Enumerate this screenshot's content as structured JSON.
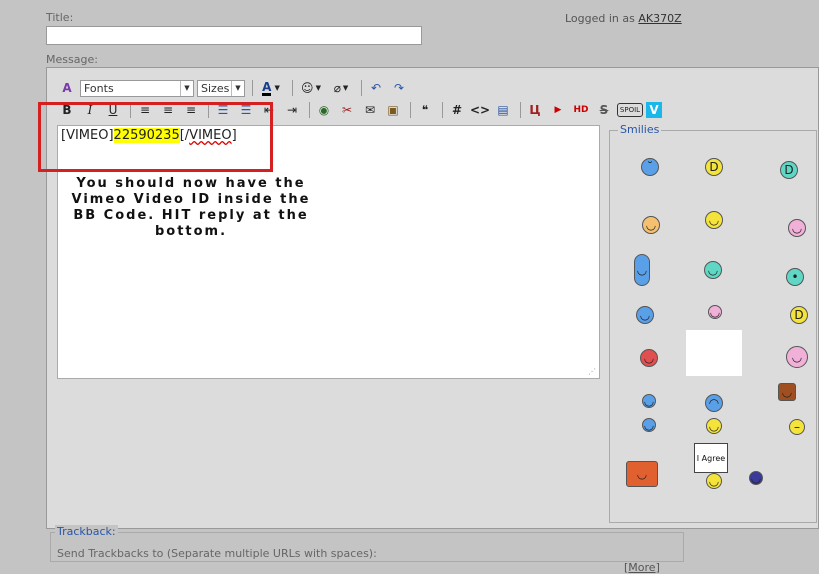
{
  "title_label": "Title:",
  "logged_in": {
    "prefix": "Logged in as",
    "user": "AK370Z"
  },
  "message_label": "Message:",
  "toolbar": {
    "fonts": "Fonts",
    "sizes": "Sizes",
    "row1_icons": [
      "remove-format-icon",
      "font-color-icon",
      "smiley-menu-icon",
      "attach-icon",
      "undo-icon",
      "redo-icon"
    ],
    "row2_icons": [
      "bold-icon",
      "italic-icon",
      "underline-icon",
      "align-left-icon",
      "align-center-icon",
      "align-right-icon",
      "ordered-list-icon",
      "unordered-list-icon",
      "outdent-icon",
      "indent-icon",
      "insert-link-icon",
      "unlink-icon",
      "insert-email-icon",
      "insert-image-icon",
      "quote-icon",
      "code-hash-icon",
      "code-html-icon",
      "php-icon",
      "youtube-alt-icon",
      "youtube-icon",
      "youtube-hd-icon",
      "strike-icon",
      "spoiler-icon",
      "vimeo-icon"
    ],
    "bold": "B",
    "italic": "I",
    "underline": "U",
    "hash": "#",
    "html": "<>",
    "strike": "S",
    "spoil": "SPOIL",
    "vimeo": "V"
  },
  "editor": {
    "tag_open": "[VIMEO]",
    "video_id": "22590235",
    "tag_close_slash": "[/",
    "tag_close_name": "VIMEO",
    "tag_close_end": "]"
  },
  "instruction_text": "You should now have the Vimeo Video ID inside the BB Code. HIT reply at the bottom.",
  "smilies": {
    "legend": "Smilies",
    "more": "More",
    "sign_text": "I Agree",
    "icons": [
      "blue-sad-smiley",
      "laughing-smiley",
      "thumbs-up-smiley",
      "hat-smiley",
      "cheer-smiley",
      "pink-smiley",
      "blue-figure-smiley",
      "teal-figure-smiley",
      "slug-smiley",
      "blue-thumbs-smiley",
      "pink-spin-smiley",
      "big-grin-smiley",
      "drummer-smiley",
      "blank-smiley",
      "baby-smiley",
      "blue-small-smiley",
      "blue-sad2-smiley",
      "door-peek-smiley",
      "blue-grin-smiley",
      "yellow-eyes-smiley",
      "neutral-smiley",
      "door-exit-smiley",
      "i-agree-sign-smiley",
      "soccer-ball-smiley"
    ]
  },
  "trackback": {
    "legend": "Trackback:",
    "text": "Send Trackbacks to (Separate multiple URLs with spaces):"
  }
}
